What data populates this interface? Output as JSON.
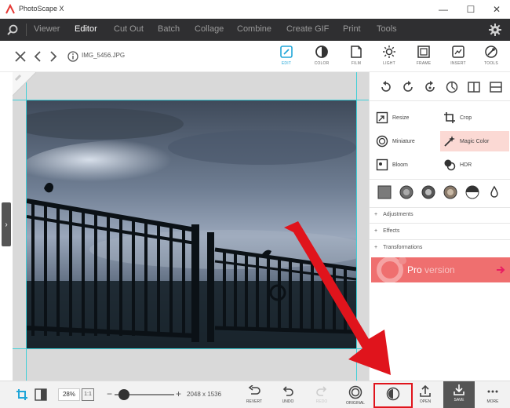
{
  "window": {
    "title": "PhotoScape X",
    "minimize": "—",
    "maximize": "☐",
    "close": "✕"
  },
  "menu": {
    "items": [
      "Viewer",
      "Editor",
      "Cut Out",
      "Batch",
      "Collage",
      "Combine",
      "Create GIF",
      "Print",
      "Tools"
    ],
    "active": "Editor"
  },
  "file": {
    "name": "IMG_5456.JPG"
  },
  "tool_tabs": [
    {
      "label": "EDIT",
      "icon": "edit-icon",
      "active": true
    },
    {
      "label": "COLOR",
      "icon": "color-icon",
      "active": false
    },
    {
      "label": "FILM",
      "icon": "film-icon",
      "active": false
    },
    {
      "label": "LIGHT",
      "icon": "light-icon",
      "active": false
    },
    {
      "label": "FRAME",
      "icon": "frame-icon",
      "active": false
    },
    {
      "label": "INSERT",
      "icon": "insert-icon",
      "active": false
    },
    {
      "label": "TOOLS",
      "icon": "tools-icon",
      "active": false
    }
  ],
  "features": [
    {
      "label": "Resize",
      "icon": "resize-icon"
    },
    {
      "label": "Crop",
      "icon": "crop-icon"
    },
    {
      "label": "Miniature",
      "icon": "miniature-icon"
    },
    {
      "label": "Magic Color",
      "icon": "magic-color-icon",
      "highlighted": true
    },
    {
      "label": "Bloom",
      "icon": "bloom-icon"
    },
    {
      "label": "HDR",
      "icon": "hdr-icon"
    }
  ],
  "accordion": [
    {
      "label": "Adjustments",
      "toggle": "+"
    },
    {
      "label": "Effects",
      "toggle": "+"
    },
    {
      "label": "Transformations",
      "toggle": "+"
    }
  ],
  "promo": {
    "text": "Pro",
    "faded": " version"
  },
  "zoom": {
    "value": "28%",
    "fit_label": "1:1",
    "level_fraction": 0.08
  },
  "image_dimensions": "2048 x 1536",
  "actions": [
    {
      "label": "REVERT",
      "icon": "revert-icon",
      "disabled": false
    },
    {
      "label": "UNDO",
      "icon": "undo-icon",
      "disabled": false
    },
    {
      "label": "REDO",
      "icon": "redo-icon",
      "disabled": true
    },
    {
      "label": "ORIGINAL",
      "icon": "original-icon",
      "disabled": false
    },
    {
      "label": "",
      "icon": "compare-icon",
      "disabled": false,
      "highlighted": true
    },
    {
      "label": "OPEN",
      "icon": "open-icon",
      "disabled": false
    },
    {
      "label": "SAVE",
      "icon": "save-icon",
      "disabled": false
    },
    {
      "label": "MORE",
      "icon": "more-icon",
      "disabled": false
    }
  ],
  "colors": {
    "accent": "#21a6d8",
    "menubar": "#2f2f31",
    "highlight": "#fbd9d4",
    "annotation": "#e0141c",
    "promo": "#ef6f6f"
  }
}
